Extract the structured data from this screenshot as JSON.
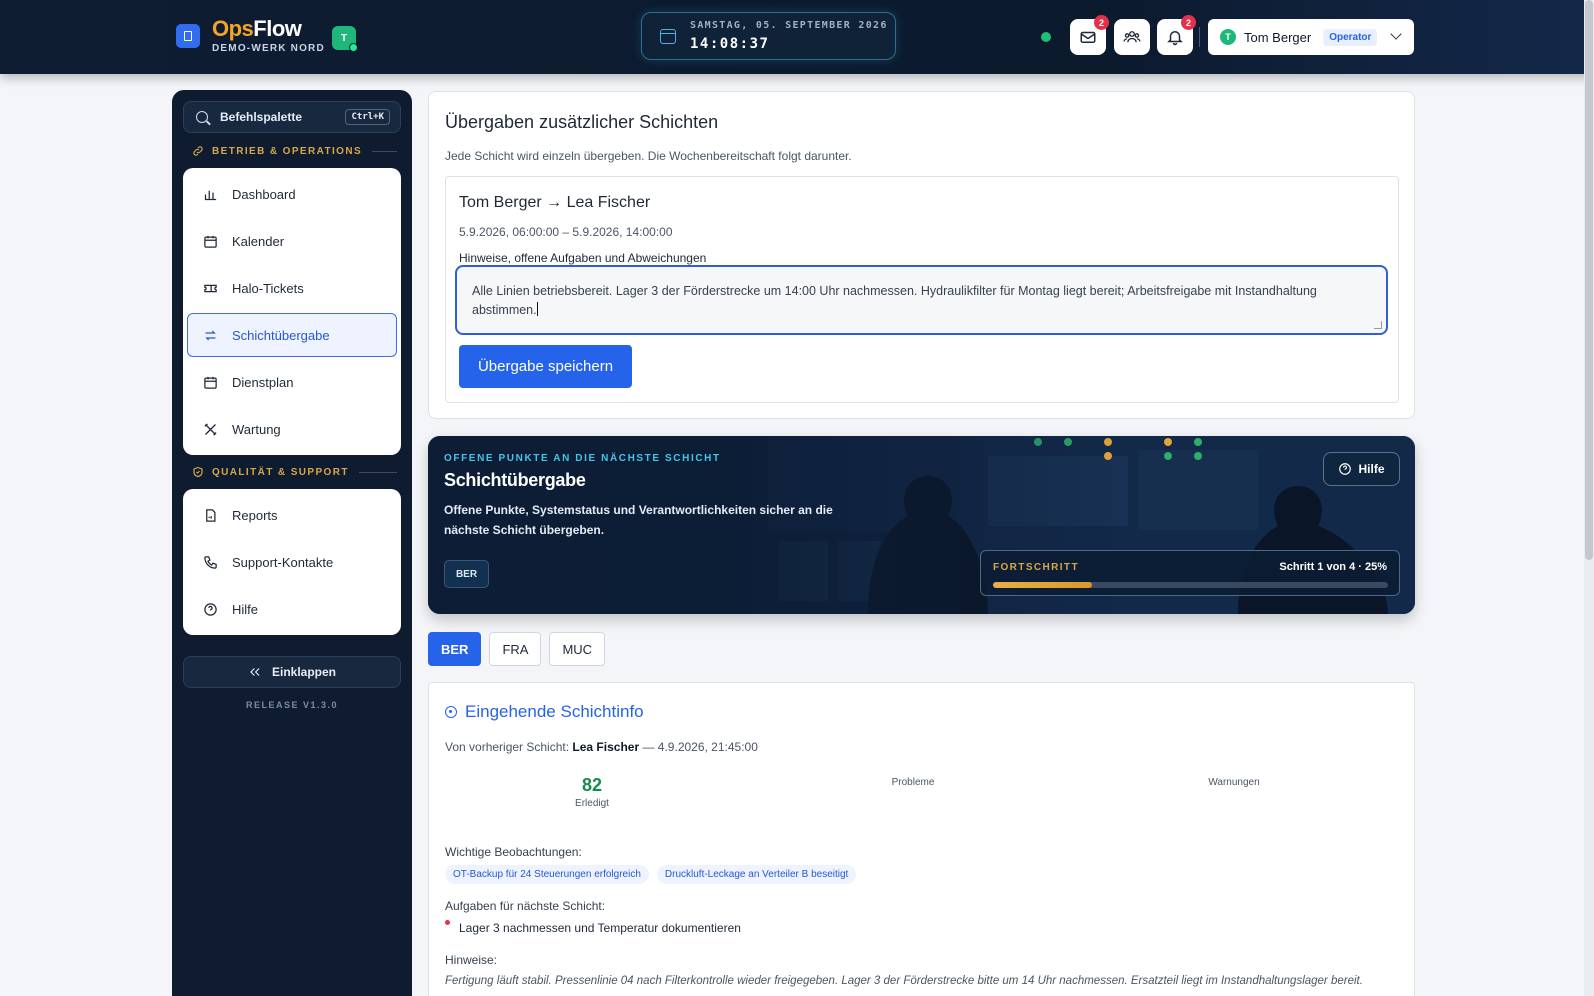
{
  "header": {
    "brand_ops": "Ops",
    "brand_flow": "Flow",
    "brand_sub": "DEMO-WERK NORD",
    "brand_badge": "T",
    "date": "SAMSTAG, 05. SEPTEMBER 2026",
    "time": "14:08:37",
    "mail_badge": "2",
    "notif_badge": "2",
    "user_initial": "T",
    "user_name": "Tom Berger",
    "user_role": "Operator"
  },
  "sidebar": {
    "command_label": "Befehlspalette",
    "command_shortcut": "Ctrl+K",
    "section1": "BETRIEB & OPERATIONS",
    "section1_items": [
      {
        "label": "Dashboard",
        "icon": "bar-chart-icon"
      },
      {
        "label": "Kalender",
        "icon": "calendar-icon"
      },
      {
        "label": "Halo-Tickets",
        "icon": "ticket-icon"
      },
      {
        "label": "Schichtübergabe",
        "icon": "swap-icon",
        "active": true
      },
      {
        "label": "Dienstplan",
        "icon": "calendar-icon"
      },
      {
        "label": "Wartung",
        "icon": "tools-icon"
      }
    ],
    "section2": "QUALITÄT & SUPPORT",
    "section2_items": [
      {
        "label": "Reports",
        "icon": "document-icon"
      },
      {
        "label": "Support-Kontakte",
        "icon": "phone-icon"
      },
      {
        "label": "Hilfe",
        "icon": "help-icon"
      }
    ],
    "collapse_label": "Einklappen",
    "release": "RELEASE V1.3.0"
  },
  "handover": {
    "title": "Übergaben zusätzlicher Schichten",
    "subtitle": "Jede Schicht wird einzeln übergeben. Die Wochenbereitschaft folgt darunter.",
    "shift_title": "Tom Berger → Lea Fischer",
    "shift_time": "5.9.2026, 06:00:00 – 5.9.2026, 14:00:00",
    "notes_label": "Hinweise, offene Aufgaben und Abweichungen",
    "notes_value": "Alle Linien betriebsbereit. Lager 3 der Förderstrecke um 14:00 Uhr nachmessen. Hydraulikfilter für Montag liegt bereit; Arbeitsfreigabe mit Instandhaltung abstimmen.",
    "save_label": "Übergabe speichern"
  },
  "hero": {
    "kicker": "OFFENE PUNKTE AN DIE NÄCHSTE SCHICHT",
    "title": "Schichtübergabe",
    "description": "Offene Punkte, Systemstatus und Verantwortlichkeiten sicher an die nächste Schicht übergeben.",
    "site_tag": "BER",
    "help_label": "Hilfe",
    "progress_label": "FORTSCHRITT",
    "progress_step": "Schritt 1 von 4 · 25%",
    "progress_percent": 25
  },
  "site_tabs": [
    {
      "label": "BER",
      "active": true
    },
    {
      "label": "FRA",
      "active": false
    },
    {
      "label": "MUC",
      "active": false
    }
  ],
  "incoming": {
    "title": "Eingehende Schichtinfo",
    "from_prefix": "Von vorheriger Schicht:",
    "from_name": "Lea Fischer",
    "from_time": "— 4.9.2026, 21:45:00",
    "stats": [
      {
        "value": "82",
        "label": "Erledigt"
      },
      {
        "value": "",
        "label": "Probleme"
      },
      {
        "value": "",
        "label": "Warnungen"
      }
    ],
    "observations_label": "Wichtige Beobachtungen:",
    "observations": [
      "OT-Backup für 24 Steuerungen erfolgreich",
      "Druckluft-Leckage an Verteiler B beseitigt"
    ],
    "tasks_label": "Aufgaben für nächste Schicht:",
    "tasks": [
      "Lager 3 nachmessen und Temperatur dokumentieren"
    ],
    "notes_label": "Hinweise:",
    "notes": "Fertigung läuft stabil. Pressenlinie 04 nach Filterkontrolle wieder freigegeben. Lager 3 der Förderstrecke bitte um 14 Uhr nachmessen. Ersatzteil liegt im Instandhaltungslager bereit."
  },
  "colors": {
    "accent": "#2563eb",
    "header_bg": "#0f1d33",
    "brand_orange": "#f5a524",
    "section_gold": "#d6a74a",
    "success": "#168a4f",
    "badge_red": "#e5304a"
  }
}
